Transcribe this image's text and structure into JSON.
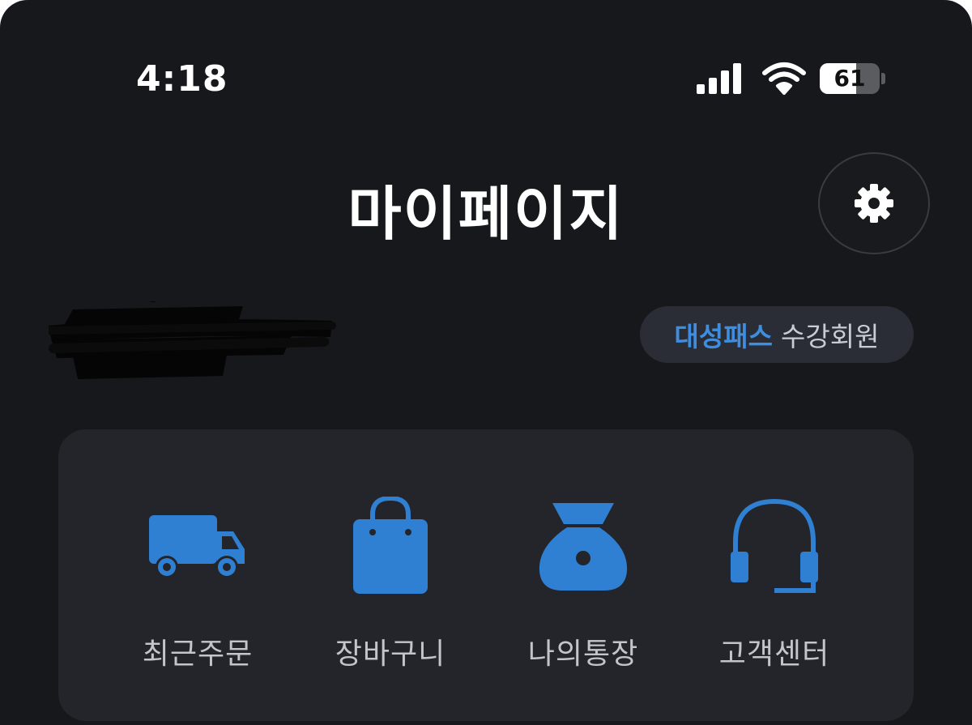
{
  "status_bar": {
    "time": "4:18",
    "battery": "61",
    "battery_level": 0.61
  },
  "header": {
    "title": "마이페이지",
    "settings_icon": "gear-icon"
  },
  "profile": {
    "badge_pass": "대성패스",
    "badge_member": "수강회원"
  },
  "quick_menu": {
    "items": [
      {
        "label": "최근주문",
        "icon": "truck-icon"
      },
      {
        "label": "장바구니",
        "icon": "shopping-bag-icon"
      },
      {
        "label": "나의통장",
        "icon": "money-bag-icon"
      },
      {
        "label": "고객센터",
        "icon": "headset-icon"
      }
    ]
  },
  "colors": {
    "background": "#17181c",
    "card": "#23252a",
    "accent": "#2f7fd2",
    "badge_accent": "#3d8ee0"
  }
}
